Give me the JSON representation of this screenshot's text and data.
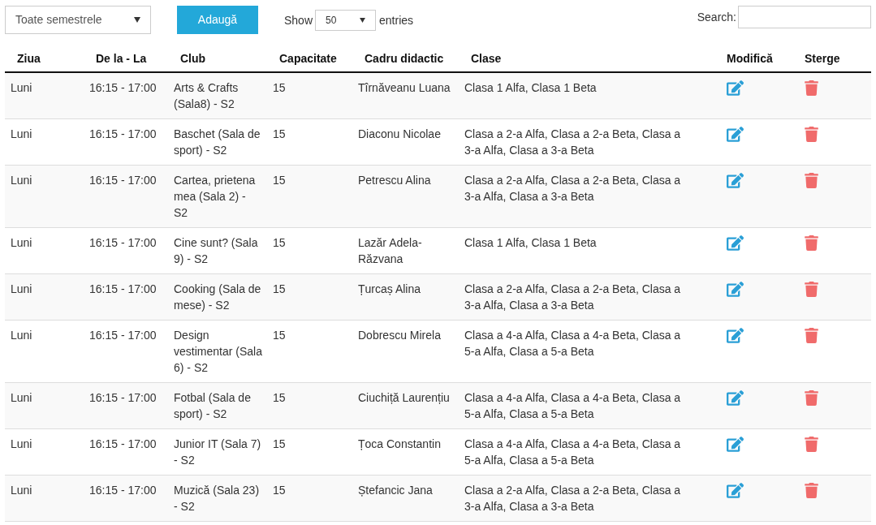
{
  "toolbar": {
    "semester_select": "Toate semestrele",
    "add_button": "Adaugă",
    "show_label": "Show",
    "entries_select": "50",
    "entries_label": "entries",
    "search_label": "Search:"
  },
  "table": {
    "columns": [
      "Ziua",
      "De la - La",
      "Club",
      "Capacitate",
      "Cadru didactic",
      "Clase",
      "Modifică",
      "Sterge"
    ],
    "rows": [
      {
        "day": "Luni",
        "time": "16:15 - 17:00",
        "club": "Arts & Crafts (Sala8) - S2",
        "capacity": "15",
        "teacher": "Tîrnăveanu Luana",
        "classes": "Clasa 1 Alfa, Clasa 1 Beta"
      },
      {
        "day": "Luni",
        "time": "16:15 - 17:00",
        "club": "Baschet (Sala de sport) - S2",
        "capacity": "15",
        "teacher": "Diaconu Nicolae",
        "classes": "Clasa a 2-a Alfa, Clasa a 2-a Beta, Clasa a 3-a Alfa, Clasa a 3-a Beta"
      },
      {
        "day": "Luni",
        "time": "16:15 - 17:00",
        "club": "Cartea, prietena mea (Sala 2) - S2",
        "capacity": "15",
        "teacher": "Petrescu Alina",
        "classes": "Clasa a 2-a Alfa, Clasa a 2-a Beta, Clasa a 3-a Alfa, Clasa a 3-a Beta"
      },
      {
        "day": "Luni",
        "time": "16:15 - 17:00",
        "club": "Cine sunt? (Sala 9) - S2",
        "capacity": "15",
        "teacher": "Lazăr Adela-Răzvana",
        "classes": "Clasa 1 Alfa, Clasa 1 Beta"
      },
      {
        "day": "Luni",
        "time": "16:15 - 17:00",
        "club": "Cooking (Sala de mese) - S2",
        "capacity": "15",
        "teacher": "Țurcaș Alina",
        "classes": "Clasa a 2-a Alfa, Clasa a 2-a Beta, Clasa a 3-a Alfa, Clasa a 3-a Beta"
      },
      {
        "day": "Luni",
        "time": "16:15 - 17:00",
        "club": "Design vestimentar (Sala 6) - S2",
        "capacity": "15",
        "teacher": "Dobrescu Mirela",
        "classes": "Clasa a 4-a Alfa, Clasa a 4-a Beta, Clasa a 5-a Alfa, Clasa a 5-a Beta"
      },
      {
        "day": "Luni",
        "time": "16:15 - 17:00",
        "club": "Fotbal (Sala de sport) - S2",
        "capacity": "15",
        "teacher": "Ciuchiță Laurențiu",
        "classes": "Clasa a 4-a Alfa, Clasa a 4-a Beta, Clasa a 5-a Alfa, Clasa a 5-a Beta"
      },
      {
        "day": "Luni",
        "time": "16:15 - 17:00",
        "club": "Junior IT (Sala 7) - S2",
        "capacity": "15",
        "teacher": "Țoca Constantin",
        "classes": "Clasa a 4-a Alfa, Clasa a 4-a Beta, Clasa a 5-a Alfa, Clasa a 5-a Beta"
      },
      {
        "day": "Luni",
        "time": "16:15 - 17:00",
        "club": "Muzică (Sala 23) - S2",
        "capacity": "15",
        "teacher": "Ștefancic Jana",
        "classes": "Clasa a 2-a Alfa, Clasa a 2-a Beta, Clasa a 3-a Alfa, Clasa a 3-a Beta"
      }
    ]
  }
}
